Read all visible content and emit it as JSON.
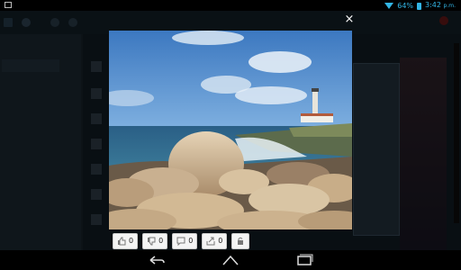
{
  "status_bar": {
    "battery_percent": "64%",
    "time": "3:42",
    "time_suffix": "p.m.",
    "accent": "#33b5e5"
  },
  "lightbox": {
    "close_label": "×",
    "image_icon": "landscape-photo-lighthouse"
  },
  "actions": [
    {
      "name": "like-button",
      "icon": "thumbs-up-icon",
      "count": "0"
    },
    {
      "name": "dislike-button",
      "icon": "thumbs-down-icon",
      "count": "0"
    },
    {
      "name": "comment-button",
      "icon": "comment-icon",
      "count": "0"
    },
    {
      "name": "share-button",
      "icon": "share-icon",
      "count": "0"
    },
    {
      "name": "lock-button",
      "icon": "lock-icon"
    }
  ],
  "nav_bar": {
    "back_icon": "back-icon",
    "home_icon": "home-icon",
    "recents_icon": "recents-icon"
  }
}
